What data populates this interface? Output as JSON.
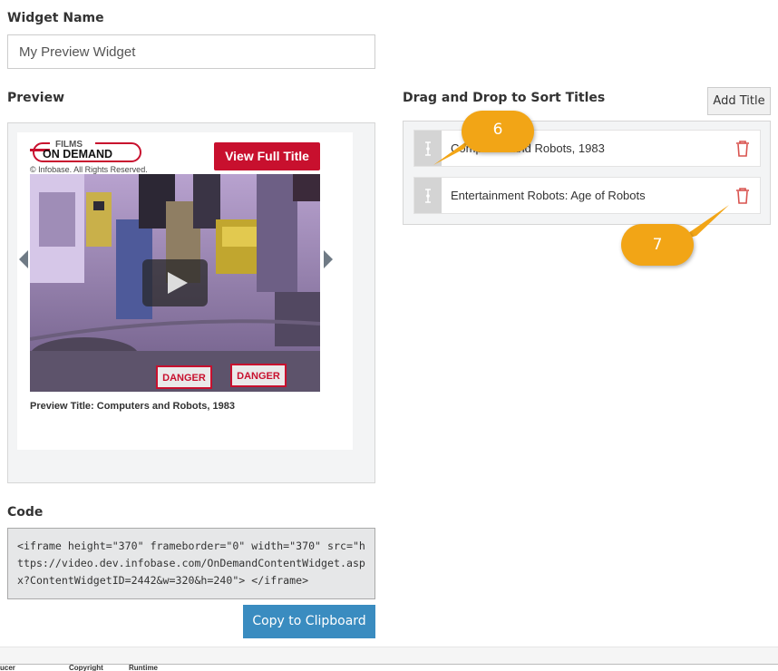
{
  "widget_name": {
    "label": "Widget Name",
    "value": "My Preview Widget"
  },
  "preview": {
    "label": "Preview",
    "logo_top": "FILMS",
    "logo_bottom": "ON DEMAND",
    "copyright": "© Infobase. All Rights Reserved.",
    "view_full_title": "View Full Title",
    "preview_title": "Preview Title: Computers and Robots, 1983",
    "sign_text": "DANGER"
  },
  "code": {
    "label": "Code",
    "snippet": "<iframe height=\"370\" frameborder=\"0\" width=\"370\" src=\"https://video.dev.infobase.com/OnDemandContentWidget.aspx?ContentWidgetID=2442&w=320&h=240\"> </iframe>",
    "copy_button": "Copy to Clipboard"
  },
  "sort": {
    "label": "Drag and Drop to Sort Titles",
    "add_title_button": "Add Title",
    "titles": [
      {
        "name": "Computers and Robots, 1983"
      },
      {
        "name": "Entertainment Robots: Age of Robots"
      }
    ]
  },
  "callouts": [
    "6",
    "7"
  ],
  "bottom_columns": [
    "ucer",
    "Copyright",
    "Runtime"
  ],
  "colors": {
    "brand_red": "#c8102e",
    "primary_blue": "#3a8cc0",
    "callout_orange": "#f2a516",
    "trash_red": "#d9534f"
  }
}
